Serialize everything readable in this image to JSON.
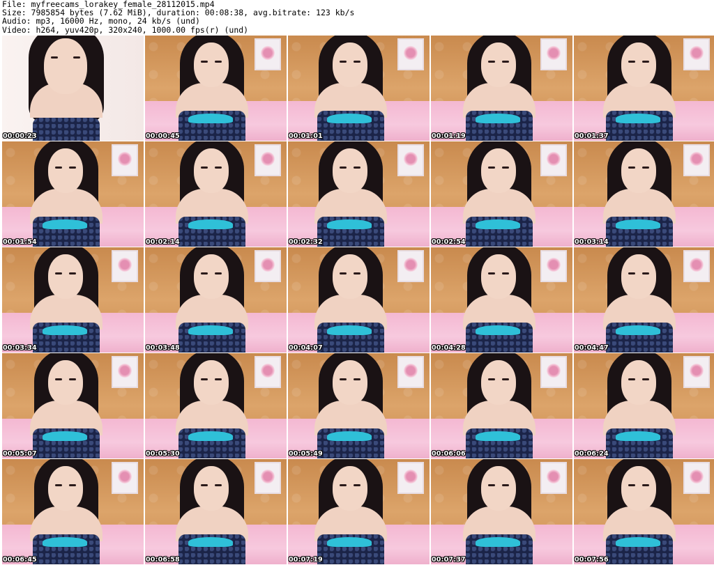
{
  "header": {
    "file_line": "File: myfreecams_lorakey_female_28112015.mp4",
    "size_line": "Size: 7985854 bytes (7.62 MiB), duration: 00:08:38, avg.bitrate: 123 kb/s",
    "audio_line": "Audio: mp3, 16000 Hz, mono, 24 kb/s (und)",
    "video_line": "Video: h264, yuv420p, 320x240, 1000.00 fps(r) (und)"
  },
  "thumbnails": [
    {
      "timestamp": "00:00:23"
    },
    {
      "timestamp": "00:00:45"
    },
    {
      "timestamp": "00:01:01"
    },
    {
      "timestamp": "00:01:19"
    },
    {
      "timestamp": "00:01:37"
    },
    {
      "timestamp": "00:01:54"
    },
    {
      "timestamp": "00:02:14"
    },
    {
      "timestamp": "00:02:32"
    },
    {
      "timestamp": "00:02:54"
    },
    {
      "timestamp": "00:03:14"
    },
    {
      "timestamp": "00:03:34"
    },
    {
      "timestamp": "00:03:48"
    },
    {
      "timestamp": "00:04:07"
    },
    {
      "timestamp": "00:04:28"
    },
    {
      "timestamp": "00:04:47"
    },
    {
      "timestamp": "00:05:07"
    },
    {
      "timestamp": "00:05:30"
    },
    {
      "timestamp": "00:05:49"
    },
    {
      "timestamp": "00:06:06"
    },
    {
      "timestamp": "00:06:24"
    },
    {
      "timestamp": "00:06:45"
    },
    {
      "timestamp": "00:06:58"
    },
    {
      "timestamp": "00:07:19"
    },
    {
      "timestamp": "00:07:37"
    },
    {
      "timestamp": "00:07:56"
    }
  ]
}
